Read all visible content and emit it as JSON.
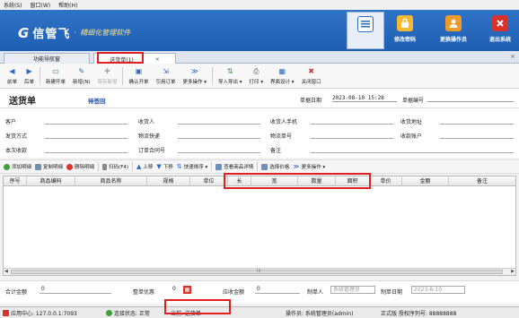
{
  "menubar": [
    {
      "label": "系统(S)"
    },
    {
      "label": "窗口(W)"
    },
    {
      "label": "帮助(H)"
    }
  ],
  "banner": {
    "logo_mark": "G",
    "brand": "信管飞",
    "separator": "·",
    "tagline": "精细化管理软件",
    "buttons": {
      "home": {
        "label": "",
        "icon": "home-icon"
      },
      "change_password": {
        "label": "修改密码",
        "icon": "lock-icon"
      },
      "change_operator": {
        "label": "更换操作员",
        "icon": "user-icon"
      },
      "exit": {
        "label": "退出系统",
        "icon": "exit-icon"
      }
    }
  },
  "tabs": {
    "nav": "功能导航窗",
    "delivery": "送货单(1)",
    "delivery_close": "×",
    "strip_close": "×"
  },
  "toolbar": [
    {
      "label": "前单",
      "glyph": "◀"
    },
    {
      "label": "后单",
      "glyph": "▶"
    },
    {
      "label": "新建开单",
      "glyph": "▭"
    },
    {
      "label": "新增(N)",
      "glyph": "✎"
    },
    {
      "label": "保存新增",
      "glyph": "✚",
      "disabled": true
    },
    {
      "label": "确认开单",
      "glyph": "▣"
    },
    {
      "label": "引用订单",
      "glyph": "⇲"
    },
    {
      "label": "更多操作 ▾",
      "glyph": "≫"
    },
    {
      "label": "导入导出 ▾",
      "glyph": "⇅"
    },
    {
      "label": "打印 ▾",
      "glyph": "⎙"
    },
    {
      "label": "界面设计 ▾",
      "glyph": "▦"
    },
    {
      "label": "关闭窗口",
      "glyph": "✖"
    }
  ],
  "doc": {
    "title": "送货单",
    "status": "待签回",
    "date_label": "单据日期",
    "date_value": "2023-08-10 15:28",
    "number_label": "单据编号",
    "number_value": ""
  },
  "form": {
    "customer": "客户",
    "receiver": "收货人",
    "receiver_phone": "收货人手机",
    "receive_address": "收货地址",
    "ship_method": "发货方式",
    "logistics_express": "物流快递",
    "logistics_no": "物流单号",
    "receive_account": "收款账户",
    "collected": "本次收款",
    "order_contract": "订单合同号",
    "remark": "备注"
  },
  "gridbar": [
    {
      "label": "添加明细",
      "color": "#3aa13a"
    },
    {
      "label": "复制明细",
      "color": "#6e8fb8"
    },
    {
      "label": "删除明细",
      "color": "#d9322b"
    },
    {
      "label": "扫码(F4)",
      "color": "#888888"
    },
    {
      "label": "上移",
      "color": "#2a6bbf"
    },
    {
      "label": "下移",
      "color": "#2a6bbf"
    },
    {
      "label": "快速排序 ▾",
      "color": "#2a6bbf"
    },
    {
      "label": "查看商品详情",
      "color": "#6e8fb8"
    },
    {
      "label": "选择价格",
      "color": "#6e8fb8"
    },
    {
      "label": "更多操作 ▾",
      "color": "#2a6bbf"
    }
  ],
  "grid": {
    "columns": [
      "序号",
      "商品编码",
      "商品名称",
      "规格",
      "单位",
      "长",
      "宽",
      "数量",
      "面积",
      "单价",
      "金额",
      "备注"
    ],
    "scroll_glyph": "III",
    "left_arrow": "◀",
    "right_arrow": "▶"
  },
  "footer": {
    "total_label": "合计金额",
    "total_value": "0",
    "discount_label": "整单优惠",
    "discount_value": "0",
    "receivable_label": "应收金额",
    "receivable_value": "0",
    "maker_label": "制单人",
    "maker_value": "系统管理员",
    "make_date_label": "制单日期",
    "make_date_value": "2023-8-10"
  },
  "statusbar": {
    "app_center": "应用中心: 127.0.0.1:7093",
    "connection": "连接状态: 正常",
    "current": "当前: 送货单",
    "operator": "操作员: 系统管理员(admin)",
    "license": "正式版 授权序列号: 88888888"
  },
  "colors": {
    "banner": "#2f73c7",
    "highlight": "#e02020",
    "status_blue": "#1a4fb3"
  }
}
